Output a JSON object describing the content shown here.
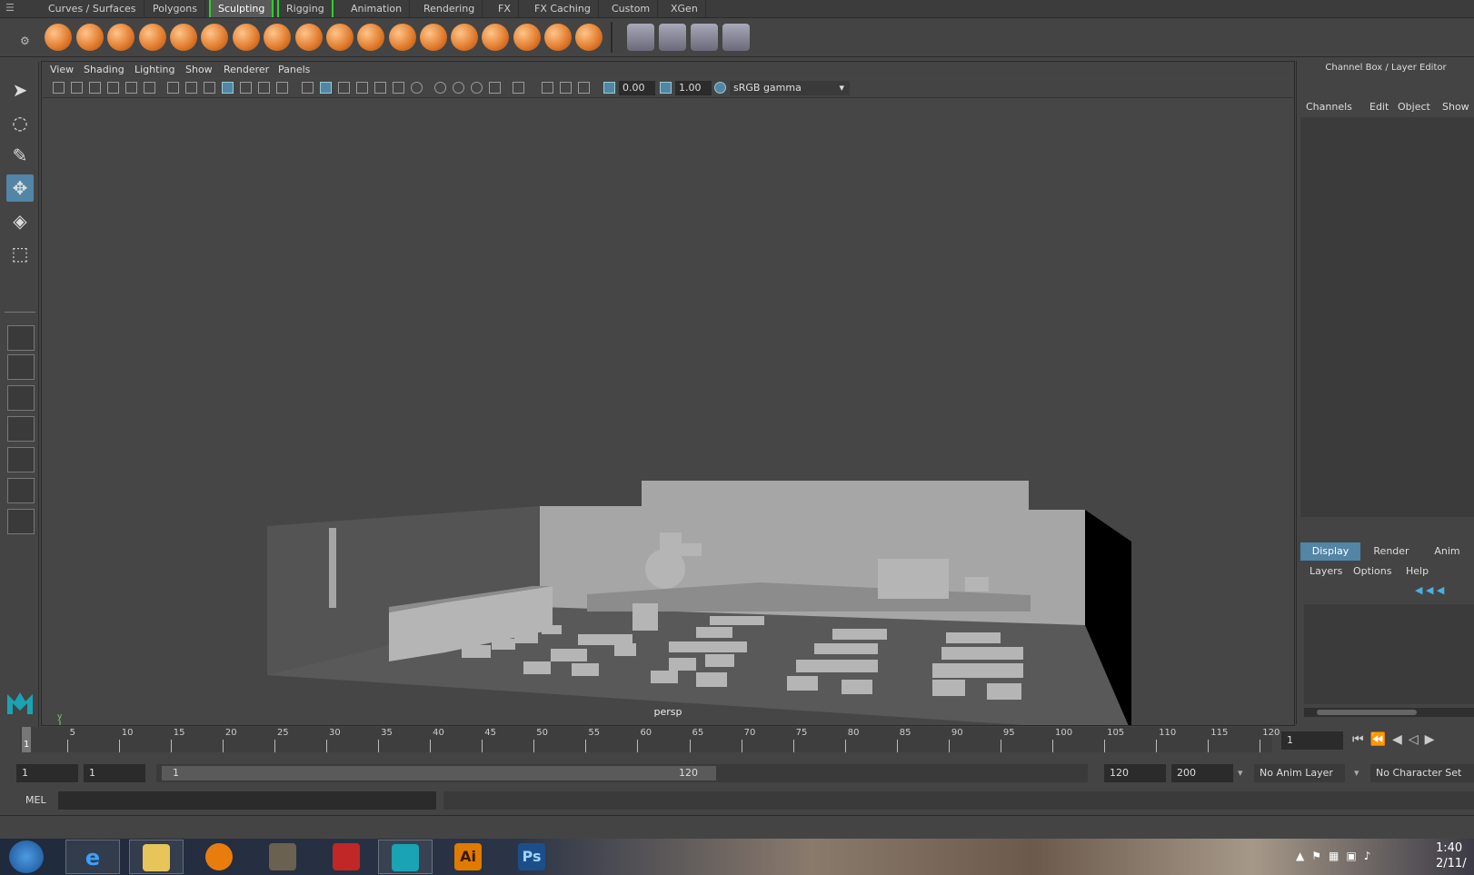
{
  "shelf": {
    "tabs": [
      "Curves / Surfaces",
      "Polygons",
      "Sculpting",
      "Rigging",
      "Animation",
      "Rendering",
      "FX",
      "FX Caching",
      "Custom",
      "XGen"
    ],
    "active_tab": "Sculpting"
  },
  "viewport": {
    "menus": [
      "View",
      "Shading",
      "Lighting",
      "Show",
      "Renderer",
      "Panels"
    ],
    "exposure": "0.00",
    "gamma": "1.00",
    "color_space": "sRGB gamma",
    "camera_label": "persp",
    "axis_labels": {
      "y": "y"
    }
  },
  "channel_box": {
    "title": "Channel Box / Layer Editor",
    "menus": [
      "Channels",
      "Edit",
      "Object",
      "Show"
    ],
    "layer_tabs": [
      "Display",
      "Render",
      "Anim"
    ],
    "layer_menus": [
      "Layers",
      "Options",
      "Help"
    ]
  },
  "timeline": {
    "ticks": [
      "5",
      "10",
      "15",
      "20",
      "25",
      "30",
      "35",
      "40",
      "45",
      "50",
      "55",
      "60",
      "65",
      "70",
      "75",
      "80",
      "85",
      "90",
      "95",
      "100",
      "105",
      "110",
      "115",
      "120"
    ],
    "current_frame_marker": "1",
    "current_frame_field": "1"
  },
  "range": {
    "start": "1",
    "playback_start": "1",
    "slider_start": "1",
    "slider_end": "120",
    "playback_end": "120",
    "end": "200",
    "anim_layer": "No Anim Layer",
    "character_set": "No Character Set"
  },
  "command_line": {
    "label": "MEL"
  },
  "taskbar": {
    "clock_time": "1:40",
    "clock_date": "2/11/",
    "apps": [
      "start",
      "internet-explorer",
      "file-explorer",
      "blender",
      "gimp",
      "autodesk-app",
      "maya",
      "illustrator",
      "photoshop"
    ],
    "illustrator_label": "Ai",
    "photoshop_label": "Ps"
  },
  "colors": {
    "active_tab_outline": "#2bd12b",
    "selection_blue": "#5285a6",
    "shelf_orange": "#e0792a"
  }
}
